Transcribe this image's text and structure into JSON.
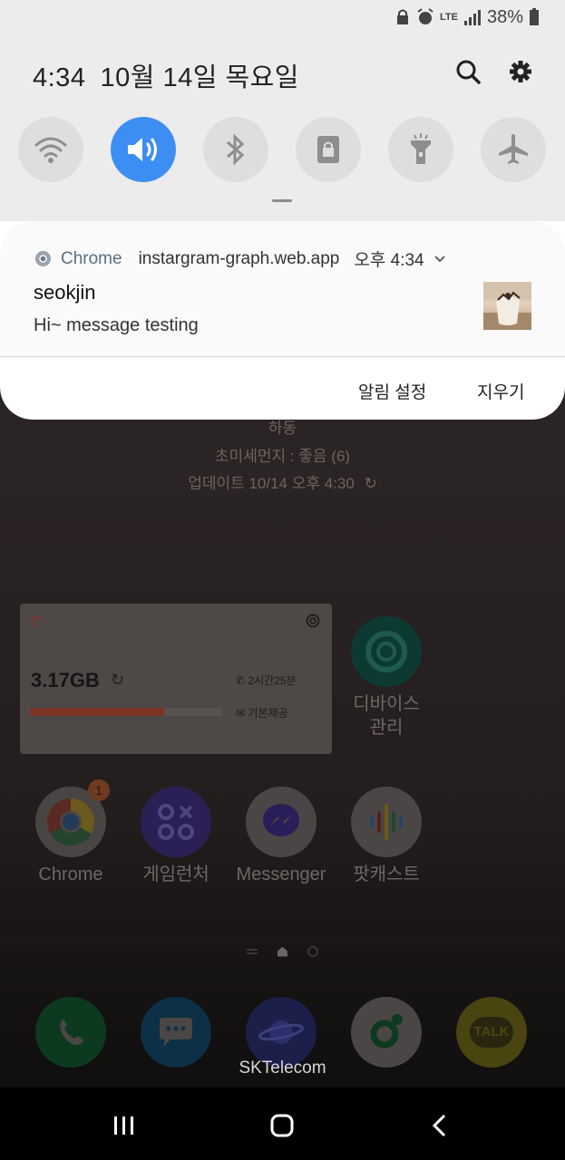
{
  "status_bar": {
    "network": "LTE",
    "battery_percent": "38%"
  },
  "header": {
    "time": "4:34",
    "date": "10월 14일 목요일"
  },
  "quick_toggles": [
    {
      "name": "wifi-icon",
      "active": false
    },
    {
      "name": "sound-icon",
      "active": true
    },
    {
      "name": "bluetooth-icon",
      "active": false
    },
    {
      "name": "rotation-lock-icon",
      "active": false
    },
    {
      "name": "flashlight-icon",
      "active": false
    },
    {
      "name": "airplane-mode-icon",
      "active": false
    }
  ],
  "notification": {
    "app_name": "Chrome",
    "site": "instargram-graph.web.app",
    "time": "오후 4:34",
    "title": "seokjin",
    "message": "Hi~ message testing",
    "settings_label": "알림 설정",
    "clear_label": "지우기"
  },
  "home": {
    "weather_location": "하동",
    "fine_dust": "초미세먼지 : 좋음 (6)",
    "updated": "업데이트 10/14 오후 4:30",
    "data_widget": {
      "remaining": "3.17GB",
      "call_time": "2시간25분",
      "sms": "기본제공",
      "usage_fraction": 0.7
    },
    "apps": [
      {
        "label": "디바이스\n관리"
      },
      {
        "label": "Chrome",
        "badge": "1"
      },
      {
        "label": "게임런처"
      },
      {
        "label": "Messenger"
      },
      {
        "label": "팟캐스트"
      }
    ],
    "dock_talk_label": "TALK",
    "carrier": "SKTelecom"
  },
  "colors": {
    "accent": "#3d8ef2",
    "panel_bg": "#ececec"
  }
}
